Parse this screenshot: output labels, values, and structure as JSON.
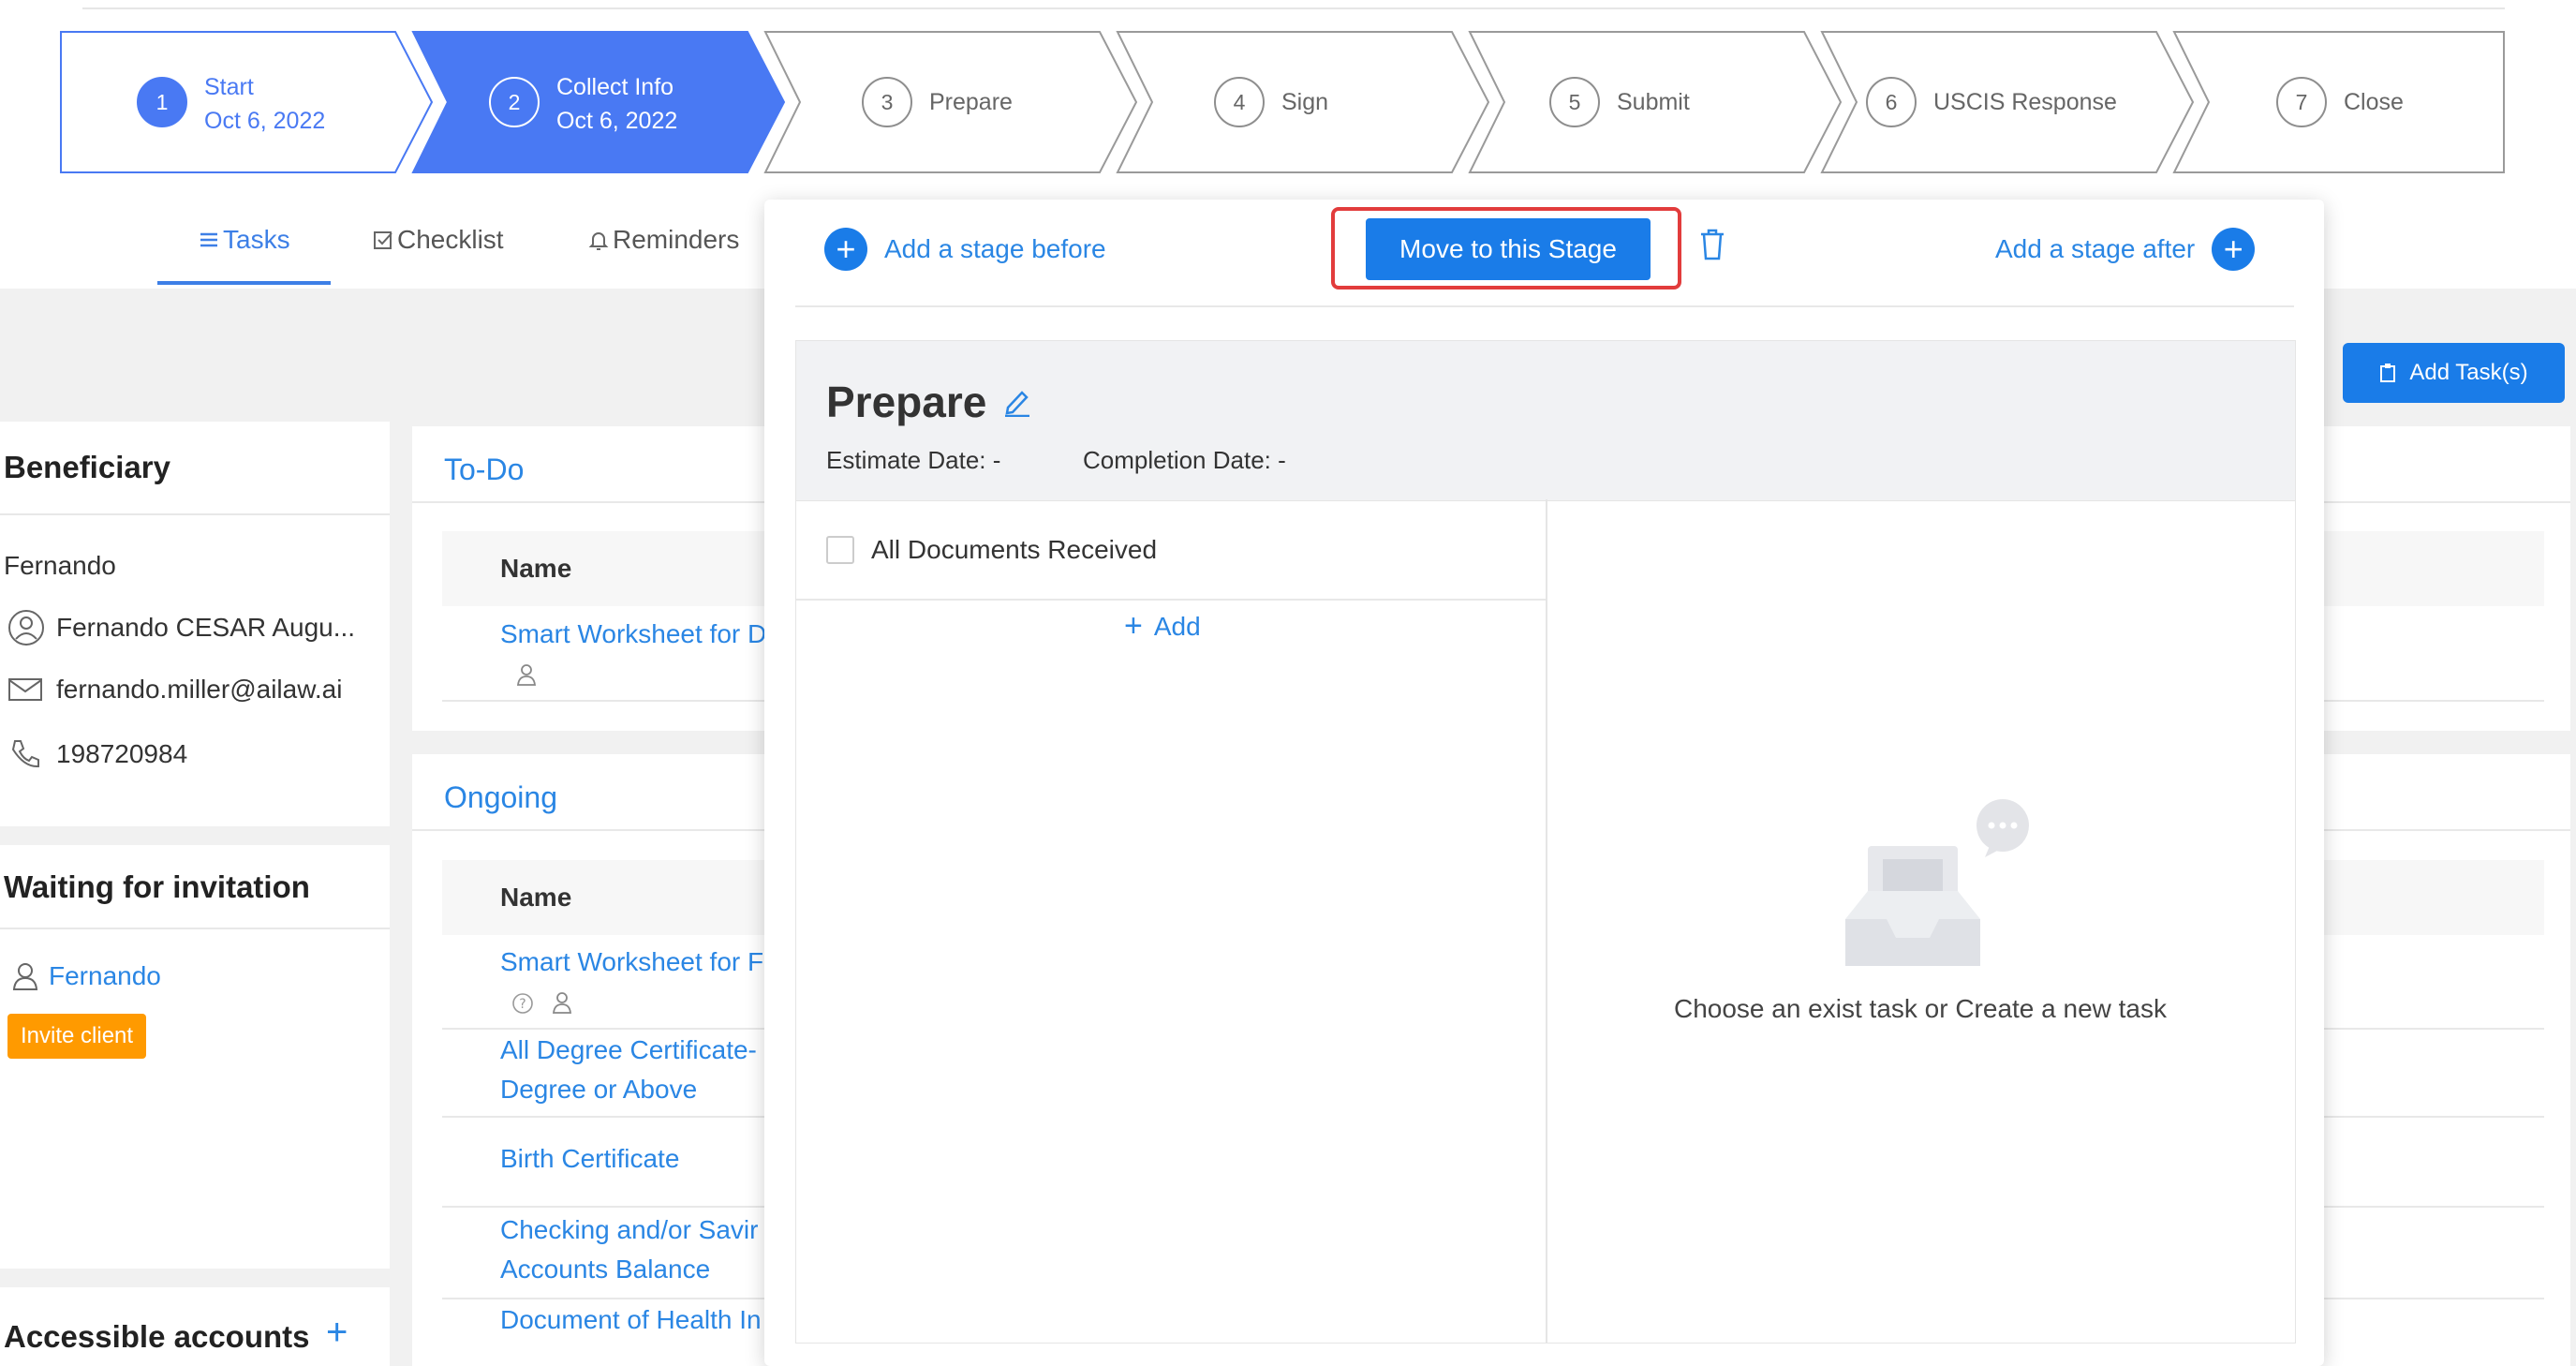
{
  "stepper": [
    {
      "num": "1",
      "label": "Start",
      "date": "Oct 6, 2022",
      "state": "done"
    },
    {
      "num": "2",
      "label": "Collect Info",
      "date": "Oct 6, 2022",
      "state": "active"
    },
    {
      "num": "3",
      "label": "Prepare",
      "date": "",
      "state": "todo"
    },
    {
      "num": "4",
      "label": "Sign",
      "date": "",
      "state": "todo"
    },
    {
      "num": "5",
      "label": "Submit",
      "date": "",
      "state": "todo"
    },
    {
      "num": "6",
      "label": "USCIS Response",
      "date": "",
      "state": "todo"
    },
    {
      "num": "7",
      "label": "Close",
      "date": "",
      "state": "todo"
    }
  ],
  "tabs": {
    "tasks": "Tasks",
    "checklist": "Checklist",
    "reminders": "Reminders"
  },
  "add_task_label": "Add Task(s)",
  "beneficiary": {
    "title": "Beneficiary",
    "first_name": "Fernando",
    "full_name": "Fernando CESAR Augu...",
    "email": "fernando.miller@ailaw.ai",
    "phone": "198720984"
  },
  "invitation": {
    "title": "Waiting for invitation",
    "name": "Fernando",
    "invite_label": "Invite client"
  },
  "accounts": {
    "title": "Accessible accounts"
  },
  "todo": {
    "title": "To-Do",
    "header": "Name",
    "rows": [
      "Smart Worksheet for D"
    ]
  },
  "ongoing": {
    "title": "Ongoing",
    "header": "Name",
    "rows": [
      {
        "line1": "Smart Worksheet for F",
        "line2": ""
      },
      {
        "line1": "All Degree Certificate-",
        "line2": "Degree or Above"
      },
      {
        "line1": "Birth Certificate",
        "line2": ""
      },
      {
        "line1": "Checking and/or Savir",
        "line2": "Accounts Balance"
      },
      {
        "line1": "Document of Health In",
        "line2": ""
      }
    ]
  },
  "popover": {
    "add_before": "Add a stage before",
    "move_label": "Move to this Stage",
    "add_after": "Add a stage after",
    "stage_name": "Prepare",
    "estimate": "Estimate Date: -",
    "completion": "Completion Date: -",
    "checkbox_label": "All Documents Received",
    "add_label": "Add",
    "empty_text": "Choose an exist task or Create a new task"
  },
  "colors": {
    "accent": "#1a7ce8",
    "stepper_blue": "#4979f3",
    "invite": "#ff9a00",
    "highlight": "#e23c3c"
  }
}
